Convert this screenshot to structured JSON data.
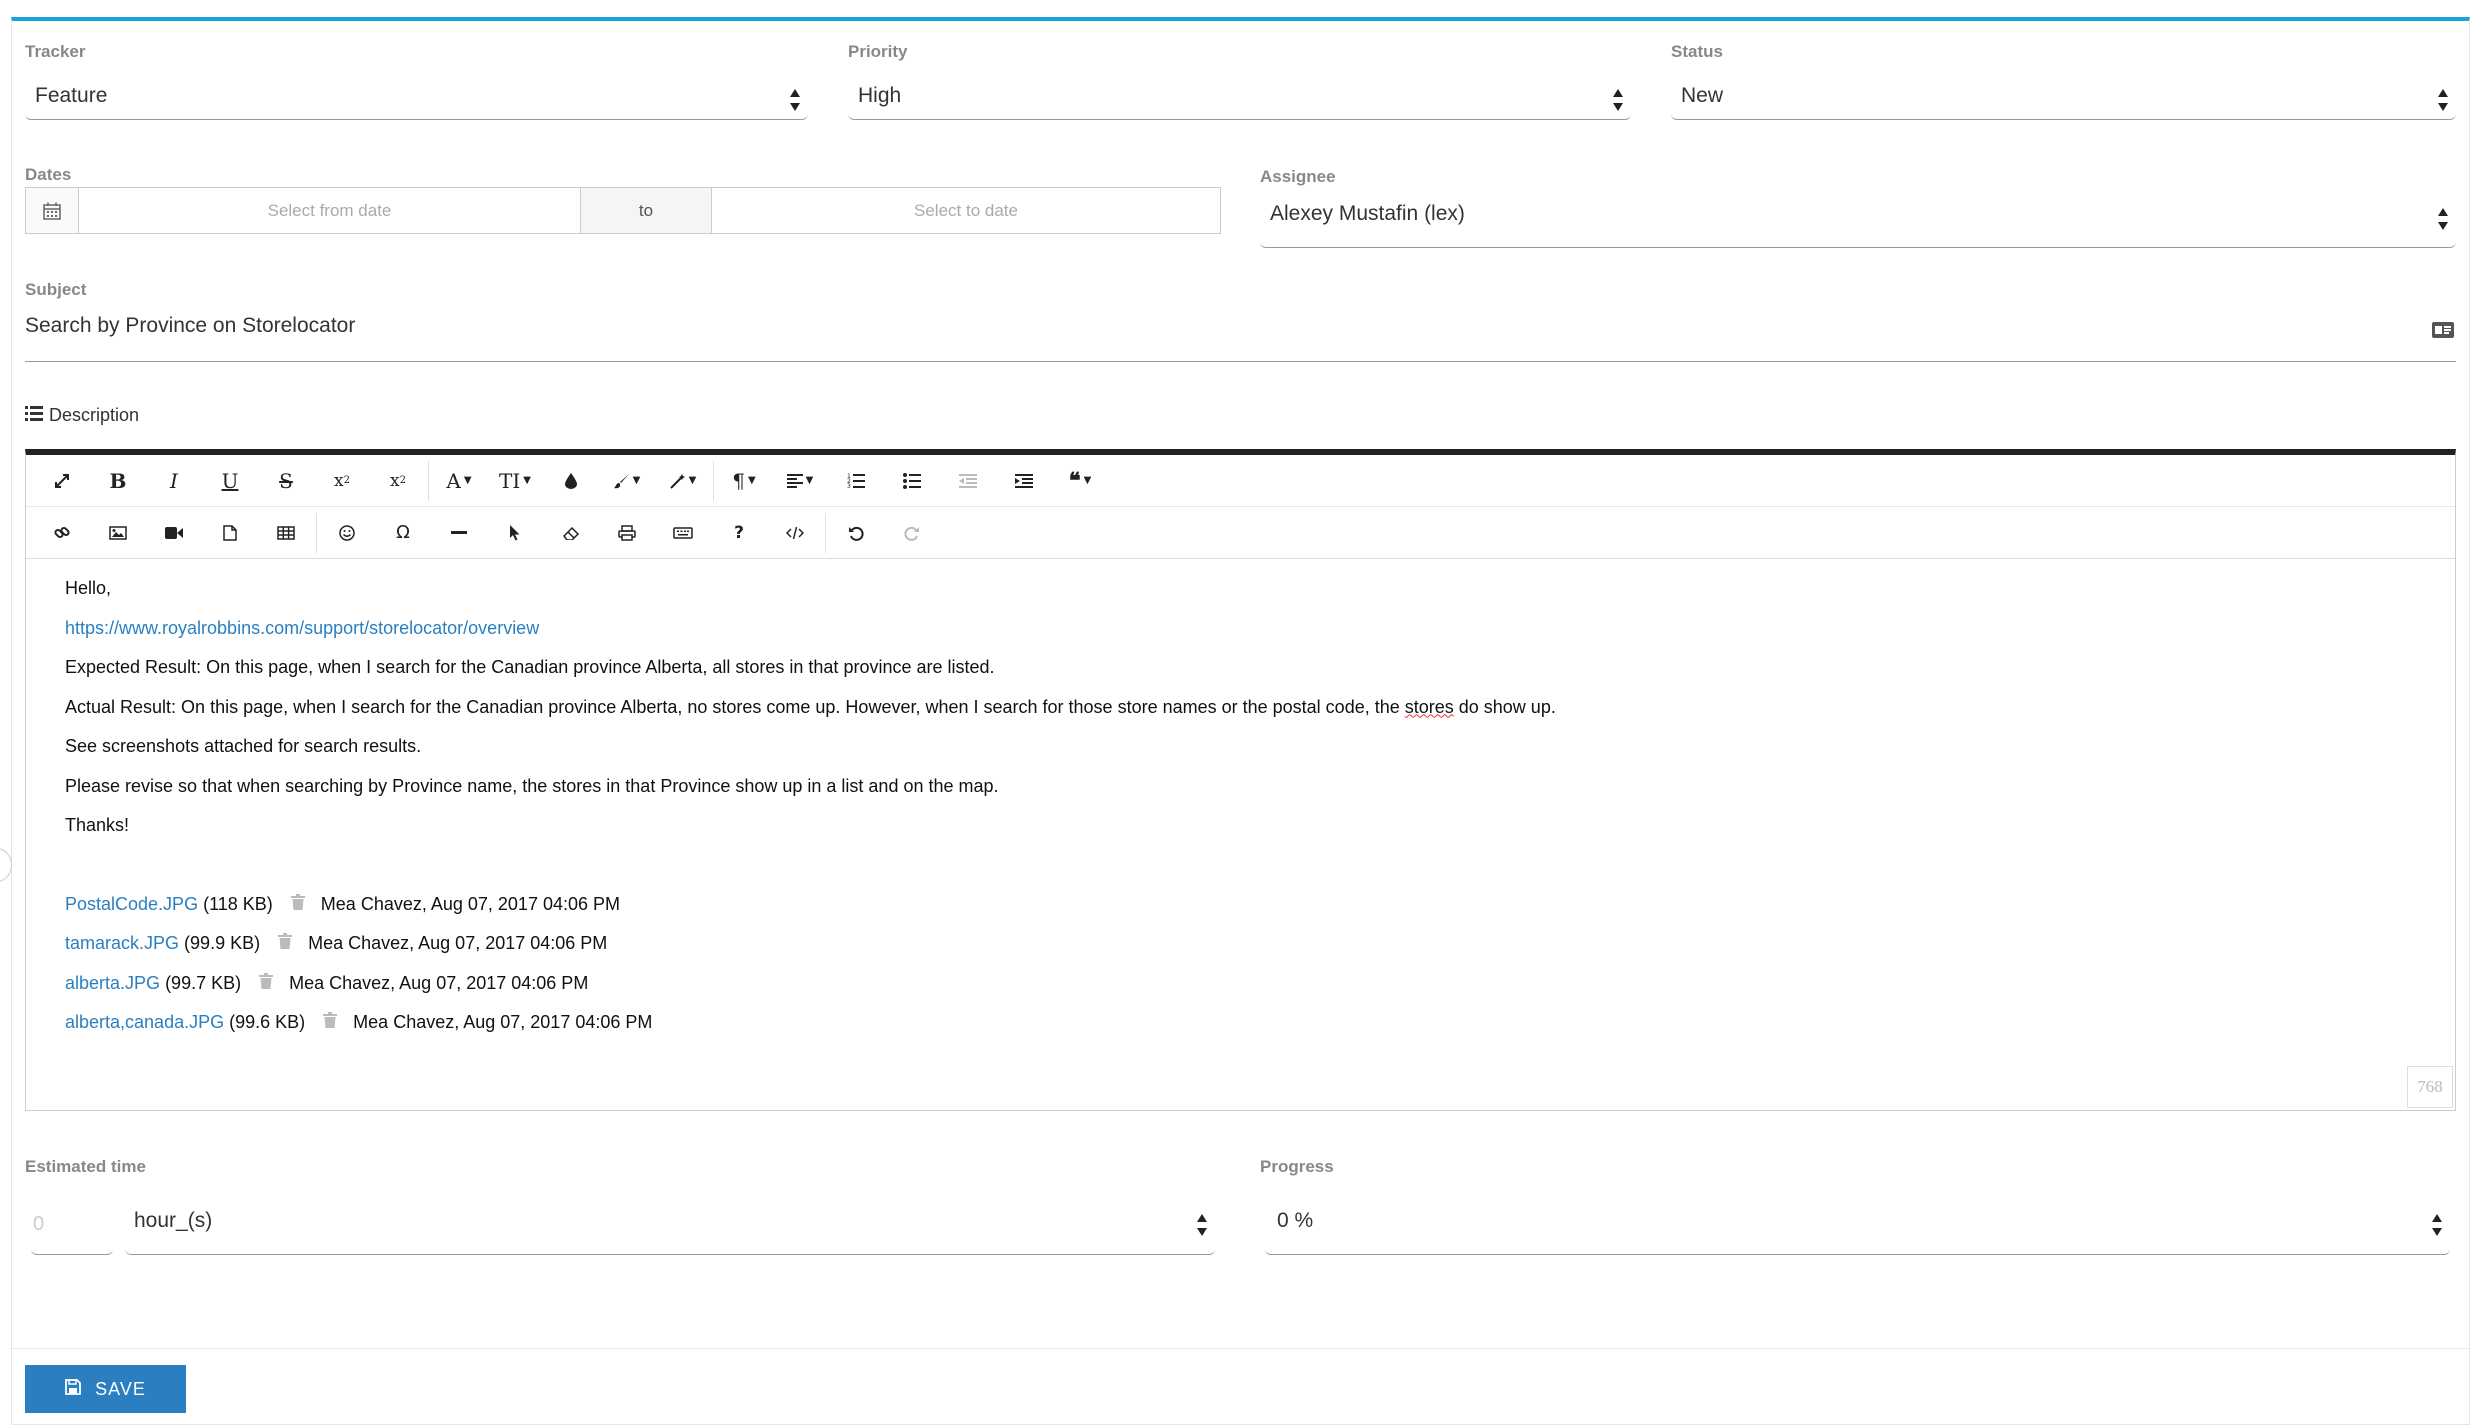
{
  "tracker": {
    "label": "Tracker",
    "value": "Feature"
  },
  "priority": {
    "label": "Priority",
    "value": "High"
  },
  "status": {
    "label": "Status",
    "value": "New"
  },
  "dates": {
    "label": "Dates",
    "from_placeholder": "Select from date",
    "to_label": "to",
    "to_placeholder": "Select to date"
  },
  "assignee": {
    "label": "Assignee",
    "value": "Alexey Mustafin (lex)"
  },
  "subject": {
    "label": "Subject",
    "value": "Search by Province on Storelocator"
  },
  "description": {
    "label": "Description",
    "greeting": "Hello,",
    "link": "https://www.royalrobbins.com/support/storelocator/overview",
    "expected": "Expected Result: On this page, when I search for the Canadian province Alberta, all stores in that province are listed.",
    "actual_before": "Actual Result: On this page, when I search for the Canadian province Alberta, no stores come up. However, when I search for those store names or the postal code, the ",
    "actual_misspelled": "stores",
    "actual_after": " do show up.",
    "screenshots": "See screenshots attached for search results.",
    "revise": "Please revise so that when searching by Province name, the stores in that Province show up in a list and on the map.",
    "thanks": "Thanks!",
    "attachments": [
      {
        "name": "PostalCode.JPG",
        "size": "(118 KB)",
        "meta": "Mea Chavez, Aug 07, 2017 04:06 PM"
      },
      {
        "name": "tamarack.JPG",
        "size": "(99.9 KB)",
        "meta": "Mea Chavez, Aug 07, 2017 04:06 PM"
      },
      {
        "name": "alberta.JPG",
        "size": "(99.7 KB)",
        "meta": "Mea Chavez, Aug 07, 2017 04:06 PM"
      },
      {
        "name": "alberta,canada.JPG",
        "size": "(99.6 KB)",
        "meta": "Mea Chavez, Aug 07, 2017 04:06 PM"
      }
    ],
    "char_counter": "768"
  },
  "estimated_time": {
    "label": "Estimated time",
    "value": "0",
    "unit": "hour_(s)"
  },
  "progress": {
    "label": "Progress",
    "value": "0 %"
  },
  "save_label": "SAVE",
  "colors": {
    "accent_top": "#1aa3dc",
    "link": "#2a7fc0",
    "save_button": "#2b7fc0"
  }
}
